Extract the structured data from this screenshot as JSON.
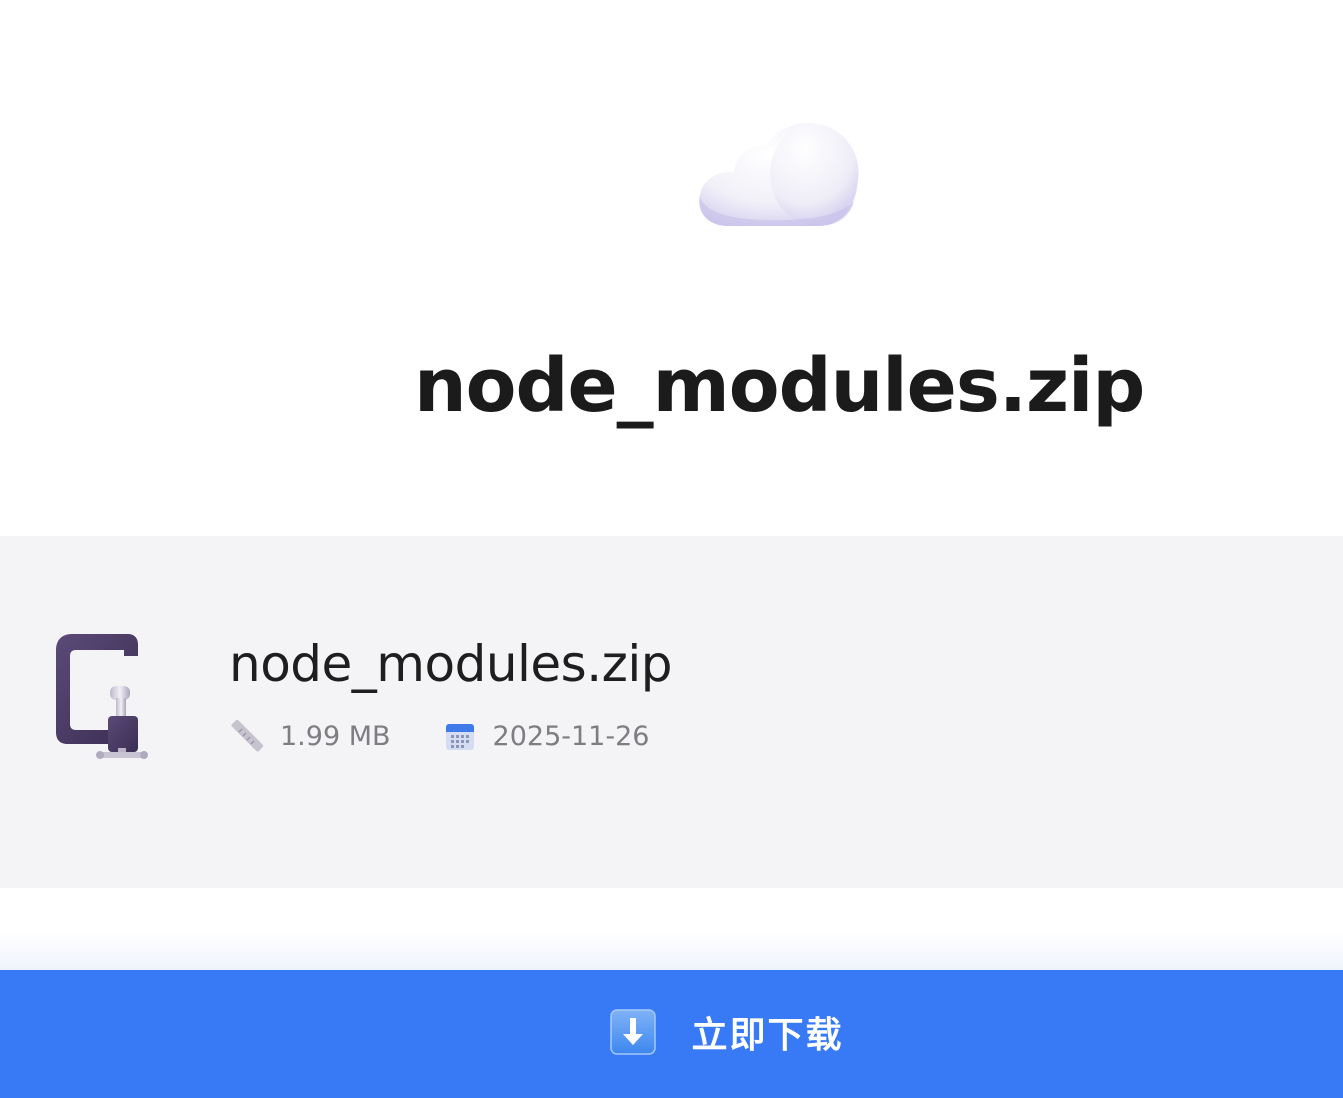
{
  "hero": {
    "title": "node_modules.zip",
    "icon": "cloud-icon"
  },
  "file": {
    "icon": "clamp-icon",
    "name": "node_modules.zip",
    "size_icon": "ruler-icon",
    "size": "1.99 MB",
    "date_icon": "calendar-icon",
    "date": "2025-11-26"
  },
  "download": {
    "icon": "download-arrow-icon",
    "label": "立即下载"
  },
  "colors": {
    "accent": "#387af5",
    "card_background": "#f4f4f6",
    "title_text": "#1b1b1b",
    "meta_text": "#7d7d82"
  }
}
